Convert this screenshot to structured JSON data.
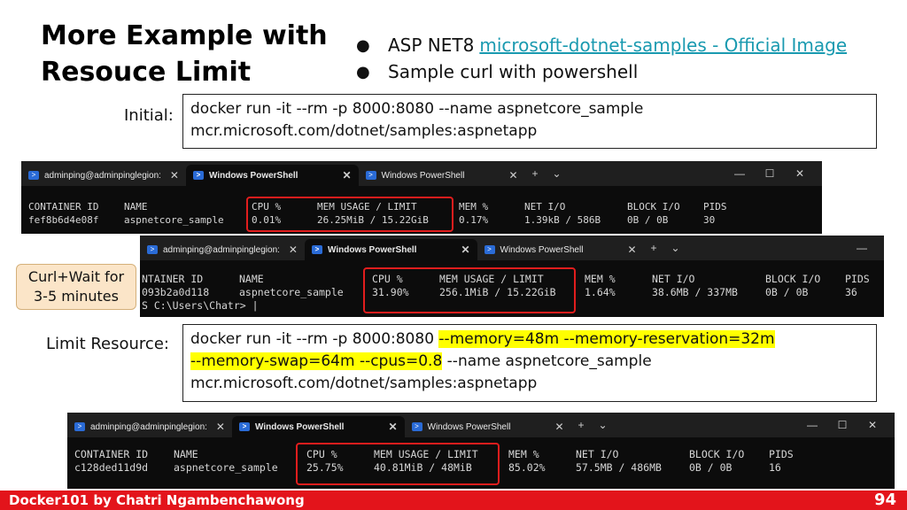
{
  "slide": {
    "title_line1": "More Example with",
    "title_line2": "Resouce Limit",
    "bullets": [
      {
        "text": "ASP NET8",
        "link": "microsoft-dotnet-samples - Official Image"
      },
      {
        "text": "Sample curl with powershell",
        "link": ""
      }
    ],
    "initial": {
      "label": "Initial:",
      "line1": "docker run -it --rm -p 8000:8080 --name aspnetcore_sample",
      "line2": "mcr.microsoft.com/dotnet/samples:aspnetapp"
    },
    "callout": {
      "line1": "Curl+Wait for",
      "line2": "3-5 minutes"
    },
    "limit": {
      "label": "Limit Resource:",
      "line1_plain": "docker run -it --rm -p 8000:8080 ",
      "line1_hl": "--memory=48m --memory-reservation=32m",
      "line2_hl": "--memory-swap=64m --cpus=0.8",
      "line2_plain": " --name aspnetcore_sample",
      "line3": "mcr.microsoft.com/dotnet/samples:aspnetapp"
    },
    "footer": {
      "author": "Docker101 by Chatri Ngambenchawong",
      "page": "94"
    }
  },
  "terminal_common": {
    "tab1": "adminping@adminpinglegion:",
    "tab2": "Windows PowerShell",
    "tab3": "Windows PowerShell",
    "close": "✕",
    "plus": "+",
    "chevron": "⌄",
    "minimize": "—",
    "maximize": "☐",
    "headers": [
      "CONTAINER ID",
      "NAME",
      "CPU %",
      "MEM USAGE / LIMIT",
      "MEM %",
      "NET I/O",
      "BLOCK I/O",
      "PIDS"
    ]
  },
  "terminals": [
    {
      "row": [
        "fef8b6d4e08f",
        "aspnetcore_sample",
        "0.01%",
        "26.25MiB / 15.22GiB",
        "0.17%",
        "1.39kB / 586B",
        "0B / 0B",
        "30"
      ]
    },
    {
      "headers": [
        "NTAINER ID",
        "NAME",
        "CPU %",
        "MEM USAGE / LIMIT",
        "MEM %",
        "NET I/O",
        "BLOCK I/O",
        "PIDS"
      ],
      "row": [
        "093b2a0d118",
        "aspnetcore_sample",
        "31.90%",
        "256.1MiB / 15.22GiB",
        "1.64%",
        "38.6MB / 337MB",
        "0B / 0B",
        "36"
      ],
      "prompt": "S C:\\Users\\Chatr>"
    },
    {
      "row": [
        "c128ded11d9d",
        "aspnetcore_sample",
        "25.75%",
        "40.81MiB / 48MiB",
        "85.02%",
        "57.5MB / 486MB",
        "0B / 0B",
        "16"
      ]
    }
  ]
}
